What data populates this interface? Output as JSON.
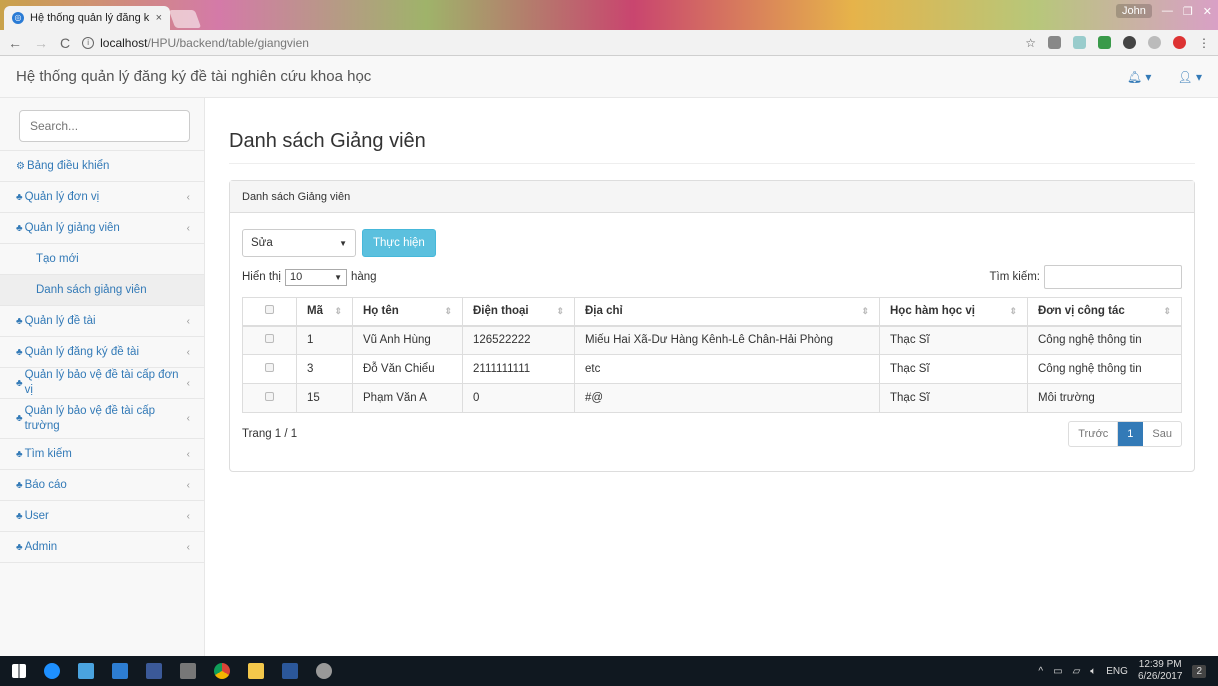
{
  "browser": {
    "tab_title": "Hệ thống quản lý đăng k",
    "tab_close": "×",
    "user": "John",
    "url_host": "localhost",
    "url_path": "/HPU/backend/table/giangvien"
  },
  "navbar": {
    "brand": "Hệ thống quản lý đăng ký đề tài nghiên cứu khoa học"
  },
  "sidebar": {
    "search_placeholder": "Search...",
    "items": [
      {
        "label": "Bảng điều khiển",
        "icon": "dashboard-icon",
        "chevron": false
      },
      {
        "label": "Quản lý đơn vị",
        "icon": "sitemap-icon",
        "chevron": true
      },
      {
        "label": "Quản lý giảng viên",
        "icon": "sitemap-icon",
        "chevron": true
      },
      {
        "label": "Quản lý đề tài",
        "icon": "sitemap-icon",
        "chevron": true
      },
      {
        "label": "Quản lý đăng ký đề tài",
        "icon": "sitemap-icon",
        "chevron": true
      },
      {
        "label": "Quản lý bảo vệ đề tài cấp đơn vị",
        "icon": "sitemap-icon",
        "chevron": true
      },
      {
        "label": "Quản lý bảo vệ đề tài cấp trường",
        "icon": "sitemap-icon",
        "chevron": true
      },
      {
        "label": "Tìm kiếm",
        "icon": "sitemap-icon",
        "chevron": true
      },
      {
        "label": "Báo cáo",
        "icon": "sitemap-icon",
        "chevron": true
      },
      {
        "label": "User",
        "icon": "sitemap-icon",
        "chevron": true
      },
      {
        "label": "Admin",
        "icon": "sitemap-icon",
        "chevron": true
      }
    ],
    "subitems": [
      {
        "label": "Tạo mới"
      },
      {
        "label": "Danh sách giảng viên"
      }
    ]
  },
  "main": {
    "page_title": "Danh sách Giảng viên",
    "panel_title": "Danh sách Giảng viên",
    "action_select": "Sửa",
    "action_button": "Thực hiện",
    "show_prefix": "Hiển thị",
    "show_value": "10",
    "show_suffix": "hàng",
    "search_label": "Tìm kiếm:",
    "columns": [
      "Mã",
      "Họ tên",
      "Điện thoại",
      "Địa chỉ",
      "Học hàm học vị",
      "Đơn vị công tác"
    ],
    "rows": [
      [
        "1",
        "Vũ Anh Hùng",
        "126522222",
        "Miếu Hai Xã-Dư Hàng Kênh-Lê Chân-Hải Phòng",
        "Thạc Sĩ",
        "Công nghệ thông tin"
      ],
      [
        "3",
        "Đỗ Văn Chiểu",
        "2111111111",
        "etc",
        "Thạc Sĩ",
        "Công nghệ thông tin"
      ],
      [
        "15",
        "Phạm Văn A",
        "0",
        "#@",
        "Thạc Sĩ",
        "Môi trường"
      ]
    ],
    "page_info": "Trang 1 / 1",
    "pager": {
      "prev": "Trước",
      "current": "1",
      "next": "Sau"
    }
  },
  "taskbar": {
    "time": "12:39 PM",
    "date": "6/26/2017",
    "lang": "ENG",
    "notif_count": "2"
  },
  "colors": {
    "accent": "#337ab7",
    "info_button": "#5bc0de",
    "taskbar": "#101820"
  }
}
